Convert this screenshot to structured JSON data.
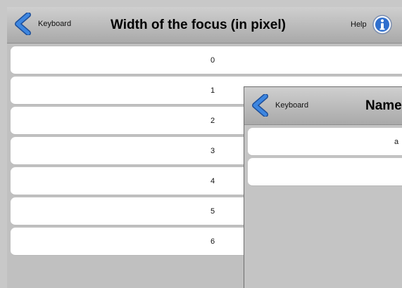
{
  "main": {
    "back_label": "Keyboard",
    "title": "Width of the focus (in pixel)",
    "help_label": "Help",
    "items": [
      {
        "label": "0"
      },
      {
        "label": "1"
      },
      {
        "label": "2"
      },
      {
        "label": "3"
      },
      {
        "label": "4"
      },
      {
        "label": "5"
      },
      {
        "label": "6"
      }
    ]
  },
  "overlay": {
    "back_label": "Keyboard",
    "title": "Name",
    "items": [
      {
        "label": "a"
      },
      {
        "label": ""
      }
    ]
  },
  "icons": {
    "back": "chevron-left-icon",
    "help": "info-icon"
  },
  "colors": {
    "chevron": "#2f6fce",
    "info": "#2f6fce"
  }
}
